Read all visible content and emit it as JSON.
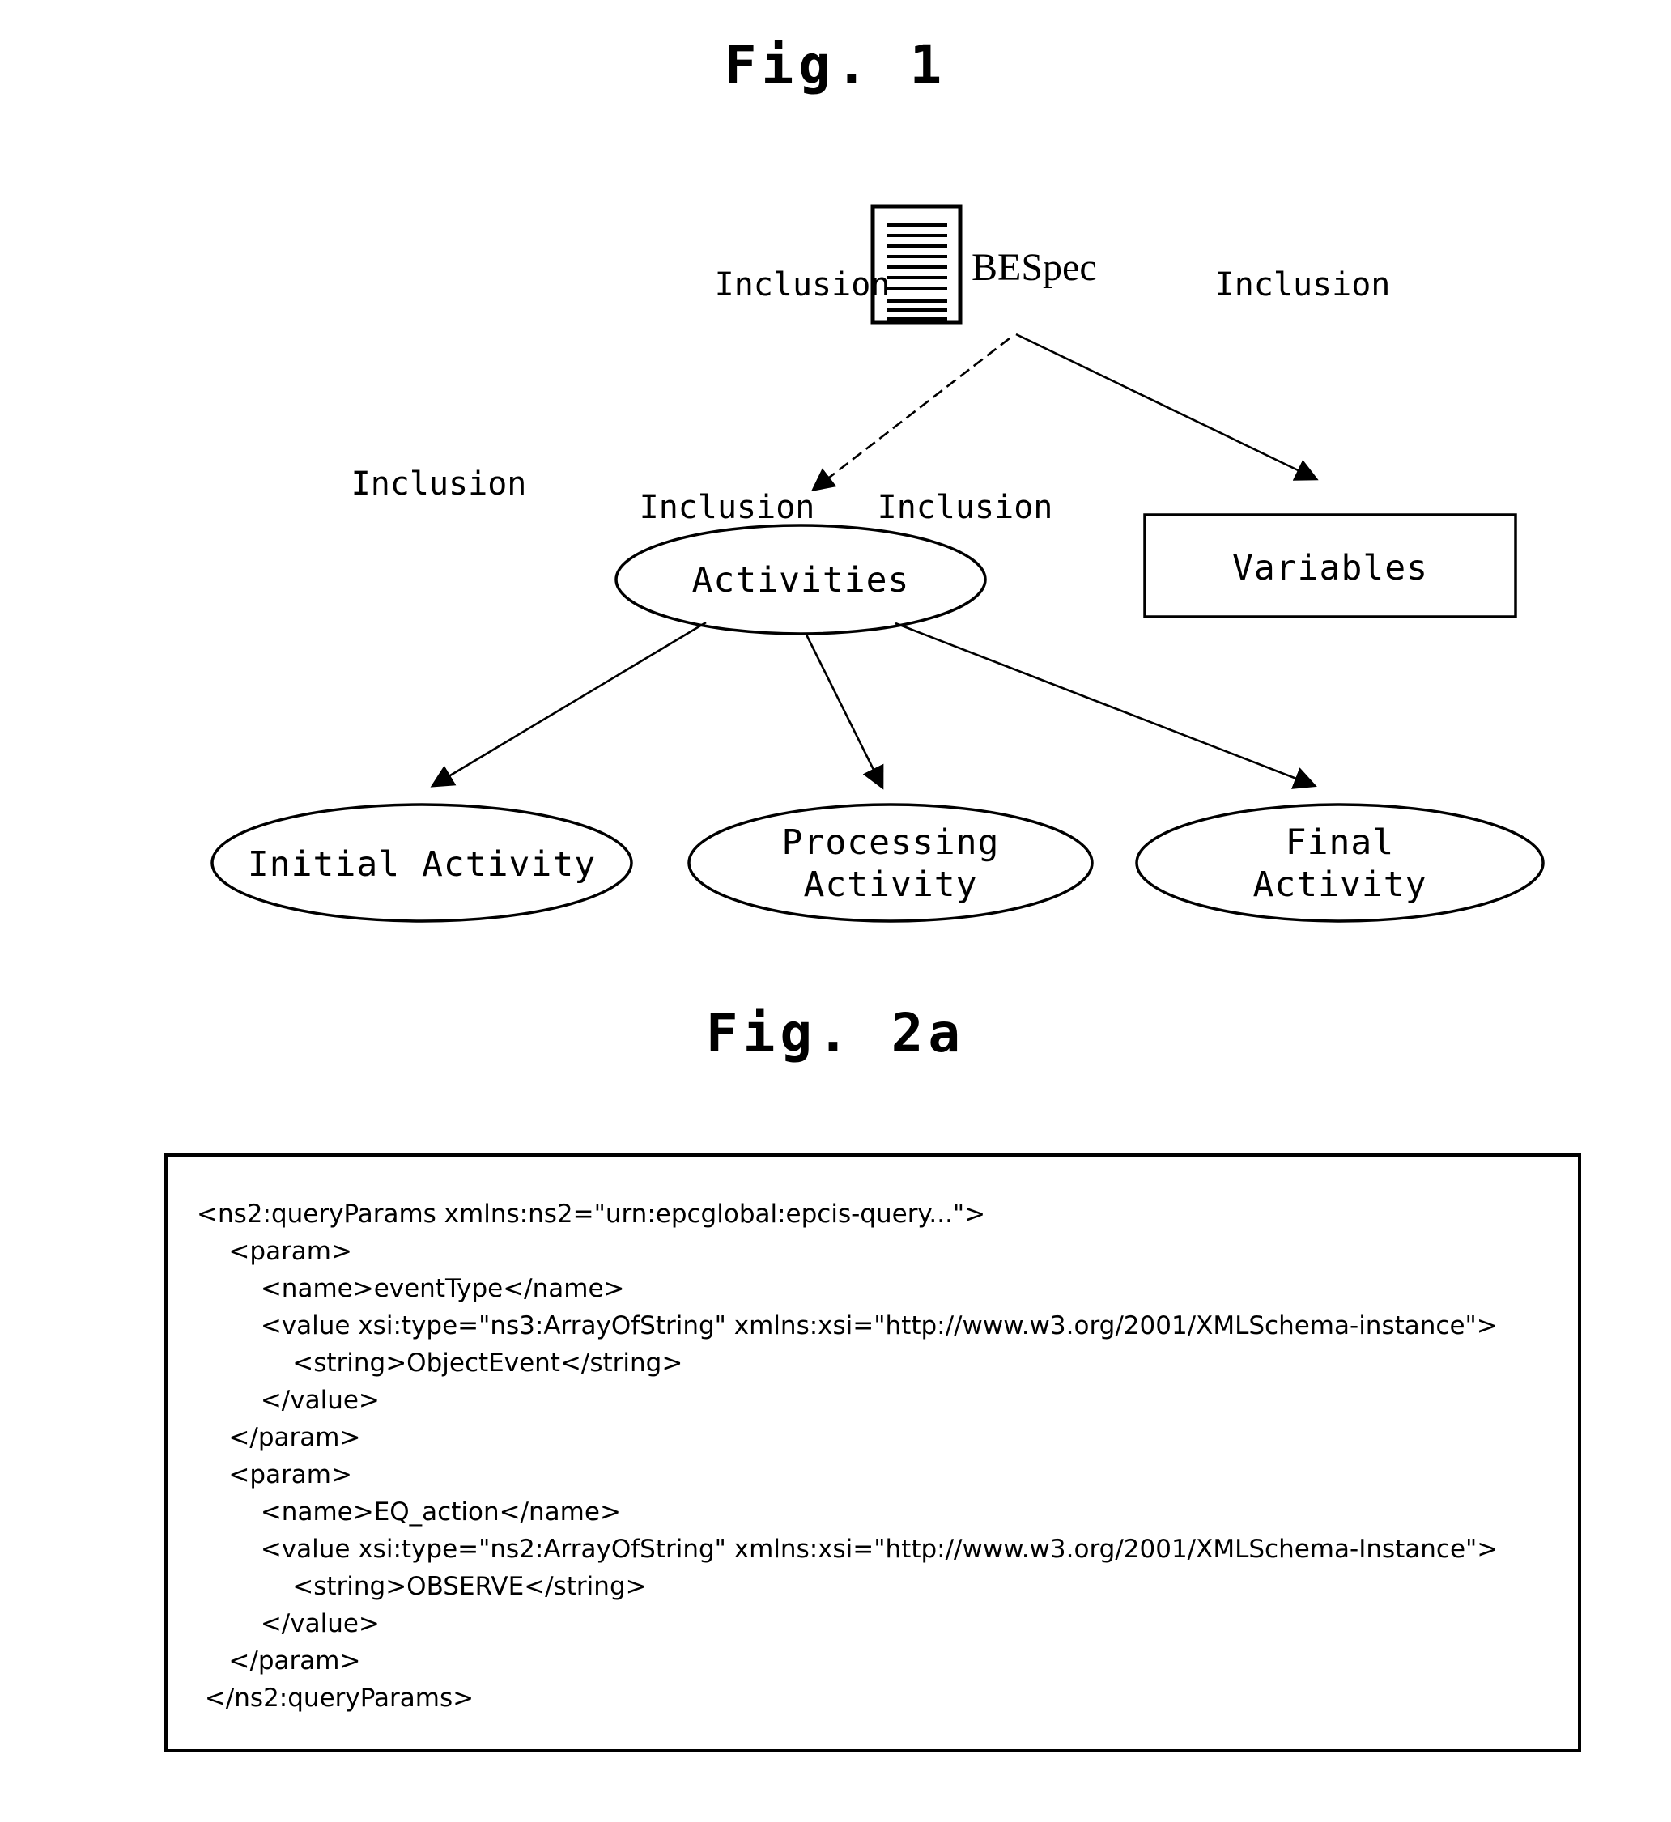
{
  "figures": {
    "fig1": {
      "title": "Fig. 1",
      "nodes": {
        "bespec": {
          "label": "BESpec",
          "shape": "document-icon"
        },
        "activities": {
          "label": "Activities",
          "shape": "ellipse"
        },
        "variables": {
          "label": "Variables",
          "shape": "rectangle"
        },
        "initial_activity": {
          "label": "Initial Activity",
          "shape": "ellipse"
        },
        "processing_activity": {
          "label_line1": "Processing",
          "label_line2": "Activity",
          "shape": "ellipse"
        },
        "final_activity": {
          "label_line1": "Final",
          "label_line2": "Activity",
          "shape": "ellipse"
        }
      },
      "edges": [
        {
          "from": "bespec",
          "to": "activities",
          "label": "Inclusion",
          "style": "dashed"
        },
        {
          "from": "bespec",
          "to": "variables",
          "label": "Inclusion",
          "style": "solid"
        },
        {
          "from": "activities",
          "to": "initial_activity",
          "label": "Inclusion",
          "style": "solid"
        },
        {
          "from": "activities",
          "to": "processing_activity",
          "label": "Inclusion",
          "style": "solid"
        },
        {
          "from": "activities",
          "to": "final_activity",
          "label": "Inclusion",
          "style": "solid"
        }
      ],
      "edge_labels": {
        "l1": "Inclusion",
        "l2": "Inclusion",
        "l3": "Inclusion",
        "l4": "Inclusion",
        "l5": "Inclusion"
      }
    },
    "fig2a": {
      "title": "Fig. 2a",
      "code_lines": [
        "<ns2:queryParams xmlns:ns2=\"urn:epcglobal:epcis-query...\">",
        "    <param>",
        "        <name>eventType</name>",
        "        <value xsi:type=\"ns3:ArrayOfString\" xmlns:xsi=\"http://www.w3.org/2001/XMLSchema-instance\">",
        "            <string>ObjectEvent</string>",
        "        </value>",
        "    </param>",
        "    <param>",
        "        <name>EQ_action</name>",
        "        <value xsi:type=\"ns2:ArrayOfString\" xmlns:xsi=\"http://www.w3.org/2001/XMLSchema-Instance\">",
        "            <string>OBSERVE</string>",
        "        </value>",
        "    </param>",
        " </ns2:queryParams>"
      ]
    }
  },
  "colors": {
    "ink": "#000000",
    "paper": "#ffffff"
  }
}
